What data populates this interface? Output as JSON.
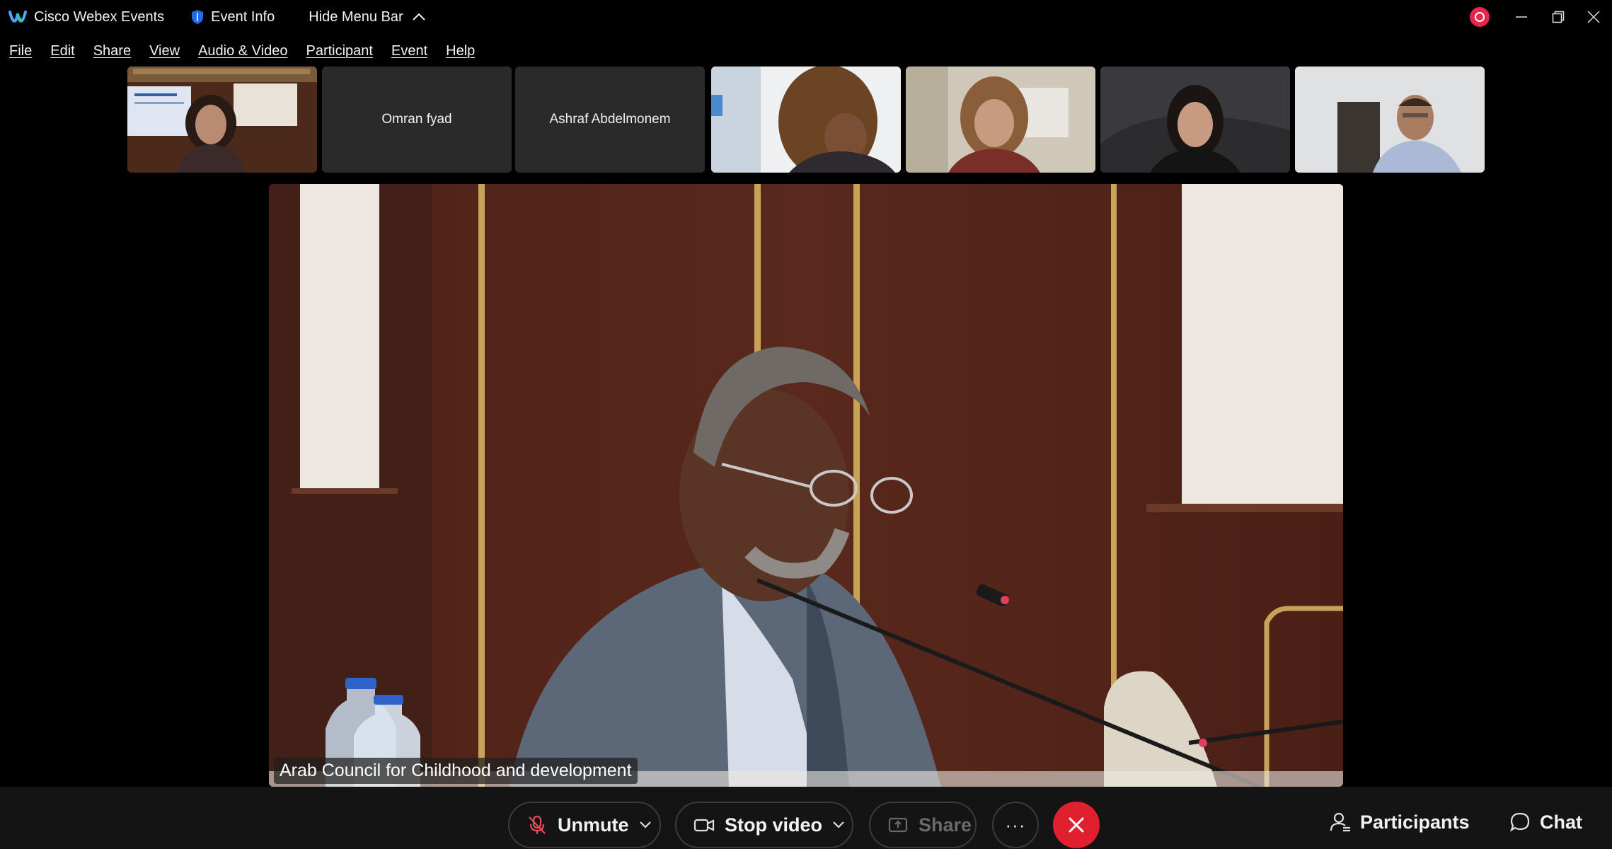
{
  "titlebar": {
    "app_name": "Cisco Webex Events",
    "event_info": "Event Info",
    "hide_menu": "Hide Menu Bar"
  },
  "menu": [
    "File",
    "Edit",
    "Share",
    "View",
    "Audio & Video",
    "Participant",
    "Event",
    "Help"
  ],
  "participants": [
    {
      "name": "",
      "has_video": true
    },
    {
      "name": "Omran fyad",
      "has_video": false
    },
    {
      "name": "Ashraf Abdelmonem",
      "has_video": false
    },
    {
      "name": "",
      "has_video": true
    },
    {
      "name": "",
      "has_video": true
    },
    {
      "name": "",
      "has_video": true
    },
    {
      "name": "",
      "has_video": true
    }
  ],
  "main_video": {
    "caption": "Arab Council for Childhood and development"
  },
  "controls": {
    "unmute": "Unmute",
    "stop_video": "Stop video",
    "share": "Share",
    "more": "···",
    "participants": "Participants",
    "chat": "Chat"
  },
  "colors": {
    "leave": "#e0202e",
    "record": "#e6274b",
    "background": "#000000",
    "control_bar": "#141414"
  }
}
